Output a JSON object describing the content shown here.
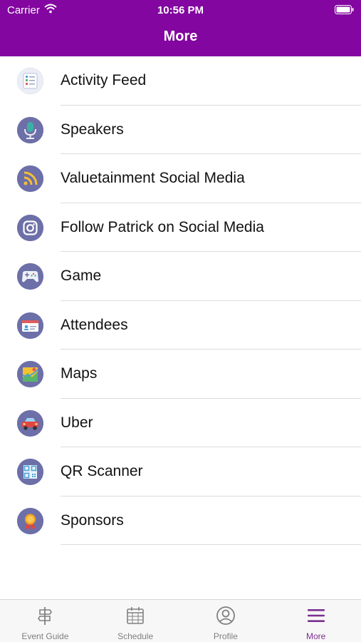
{
  "status_bar": {
    "carrier": "Carrier",
    "time": "10:56 PM"
  },
  "header": {
    "title": "More",
    "background": "#82069f"
  },
  "menu": {
    "items": [
      {
        "label": "Activity Feed",
        "icon": "activity-feed-icon"
      },
      {
        "label": "Speakers",
        "icon": "microphone-icon"
      },
      {
        "label": "Valuetainment Social Media",
        "icon": "rss-icon"
      },
      {
        "label": "Follow Patrick on Social Media",
        "icon": "instagram-icon"
      },
      {
        "label": "Game",
        "icon": "gamepad-icon"
      },
      {
        "label": "Attendees",
        "icon": "id-badge-icon"
      },
      {
        "label": "Maps",
        "icon": "map-icon"
      },
      {
        "label": "Uber",
        "icon": "car-icon"
      },
      {
        "label": "QR Scanner",
        "icon": "qr-code-icon"
      },
      {
        "label": "Sponsors",
        "icon": "medal-icon"
      }
    ]
  },
  "tab_bar": {
    "tabs": [
      {
        "label": "Event Guide",
        "icon": "signpost-icon",
        "active": false
      },
      {
        "label": "Schedule",
        "icon": "calendar-icon",
        "active": false
      },
      {
        "label": "Profile",
        "icon": "user-circle-icon",
        "active": false
      },
      {
        "label": "More",
        "icon": "menu-icon",
        "active": true
      }
    ],
    "active_color": "#7b2f8f",
    "inactive_color": "#808080"
  }
}
